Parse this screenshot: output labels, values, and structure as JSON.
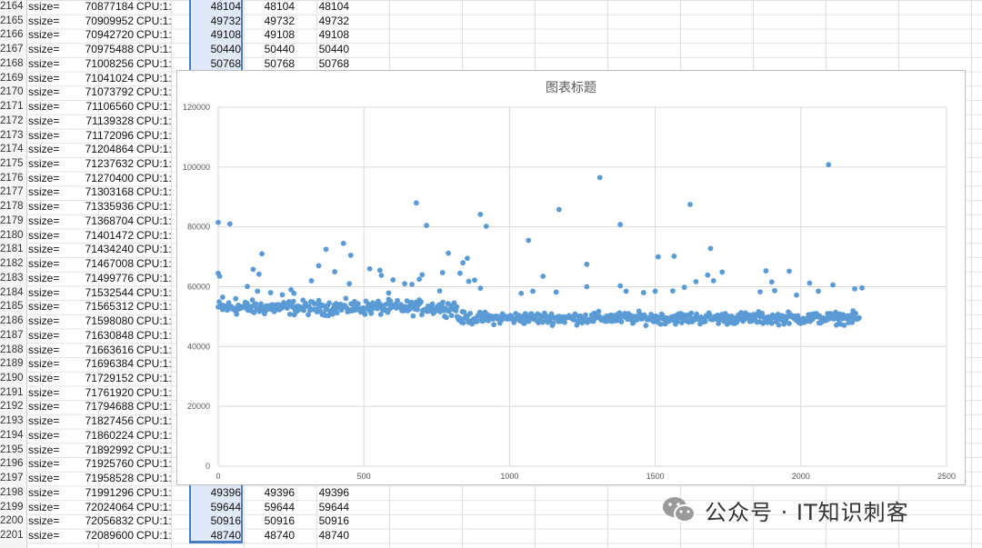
{
  "sheet": {
    "rows": [
      {
        "n": "2164",
        "ss": "ssize=",
        "v": "70877184",
        "cpu": "CPU:1:",
        "d": "48104",
        "e": "48104",
        "f": "48104"
      },
      {
        "n": "2165",
        "ss": "ssize=",
        "v": "70909952",
        "cpu": "CPU:1:",
        "d": "49732",
        "e": "49732",
        "f": "49732"
      },
      {
        "n": "2166",
        "ss": "ssize=",
        "v": "70942720",
        "cpu": "CPU:1:",
        "d": "49108",
        "e": "49108",
        "f": "49108"
      },
      {
        "n": "2167",
        "ss": "ssize=",
        "v": "70975488",
        "cpu": "CPU:1:",
        "d": "50440",
        "e": "50440",
        "f": "50440"
      },
      {
        "n": "2168",
        "ss": "ssize=",
        "v": "71008256",
        "cpu": "CPU:1:",
        "d": "50768",
        "e": "50768",
        "f": "50768"
      },
      {
        "n": "2169",
        "ss": "ssize=",
        "v": "71041024",
        "cpu": "CPU:1:",
        "d": "",
        "e": "",
        "f": ""
      },
      {
        "n": "2170",
        "ss": "ssize=",
        "v": "71073792",
        "cpu": "CPU:1:",
        "d": "",
        "e": "",
        "f": ""
      },
      {
        "n": "2171",
        "ss": "ssize=",
        "v": "71106560",
        "cpu": "CPU:1:",
        "d": "",
        "e": "",
        "f": ""
      },
      {
        "n": "2172",
        "ss": "ssize=",
        "v": "71139328",
        "cpu": "CPU:1:",
        "d": "",
        "e": "",
        "f": ""
      },
      {
        "n": "2173",
        "ss": "ssize=",
        "v": "71172096",
        "cpu": "CPU:1:",
        "d": "",
        "e": "",
        "f": ""
      },
      {
        "n": "2174",
        "ss": "ssize=",
        "v": "71204864",
        "cpu": "CPU:1:",
        "d": "",
        "e": "",
        "f": ""
      },
      {
        "n": "2175",
        "ss": "ssize=",
        "v": "71237632",
        "cpu": "CPU:1:",
        "d": "",
        "e": "",
        "f": ""
      },
      {
        "n": "2176",
        "ss": "ssize=",
        "v": "71270400",
        "cpu": "CPU:1:",
        "d": "",
        "e": "",
        "f": ""
      },
      {
        "n": "2177",
        "ss": "ssize=",
        "v": "71303168",
        "cpu": "CPU:1:",
        "d": "",
        "e": "",
        "f": ""
      },
      {
        "n": "2178",
        "ss": "ssize=",
        "v": "71335936",
        "cpu": "CPU:1:",
        "d": "",
        "e": "",
        "f": ""
      },
      {
        "n": "2179",
        "ss": "ssize=",
        "v": "71368704",
        "cpu": "CPU:1:",
        "d": "",
        "e": "",
        "f": ""
      },
      {
        "n": "2180",
        "ss": "ssize=",
        "v": "71401472",
        "cpu": "CPU:1:",
        "d": "",
        "e": "",
        "f": ""
      },
      {
        "n": "2181",
        "ss": "ssize=",
        "v": "71434240",
        "cpu": "CPU:1:",
        "d": "",
        "e": "",
        "f": ""
      },
      {
        "n": "2182",
        "ss": "ssize=",
        "v": "71467008",
        "cpu": "CPU:1:",
        "d": "",
        "e": "",
        "f": ""
      },
      {
        "n": "2183",
        "ss": "ssize=",
        "v": "71499776",
        "cpu": "CPU:1:",
        "d": "",
        "e": "",
        "f": ""
      },
      {
        "n": "2184",
        "ss": "ssize=",
        "v": "71532544",
        "cpu": "CPU:1:",
        "d": "",
        "e": "",
        "f": ""
      },
      {
        "n": "2185",
        "ss": "ssize=",
        "v": "71565312",
        "cpu": "CPU:1:",
        "d": "",
        "e": "",
        "f": ""
      },
      {
        "n": "2186",
        "ss": "ssize=",
        "v": "71598080",
        "cpu": "CPU:1:",
        "d": "",
        "e": "",
        "f": ""
      },
      {
        "n": "2187",
        "ss": "ssize=",
        "v": "71630848",
        "cpu": "CPU:1:",
        "d": "",
        "e": "",
        "f": ""
      },
      {
        "n": "2188",
        "ss": "ssize=",
        "v": "71663616",
        "cpu": "CPU:1:",
        "d": "",
        "e": "",
        "f": ""
      },
      {
        "n": "2189",
        "ss": "ssize=",
        "v": "71696384",
        "cpu": "CPU:1:",
        "d": "",
        "e": "",
        "f": ""
      },
      {
        "n": "2190",
        "ss": "ssize=",
        "v": "71729152",
        "cpu": "CPU:1:",
        "d": "",
        "e": "",
        "f": ""
      },
      {
        "n": "2191",
        "ss": "ssize=",
        "v": "71761920",
        "cpu": "CPU:1:",
        "d": "",
        "e": "",
        "f": ""
      },
      {
        "n": "2192",
        "ss": "ssize=",
        "v": "71794688",
        "cpu": "CPU:1:",
        "d": "",
        "e": "",
        "f": ""
      },
      {
        "n": "2193",
        "ss": "ssize=",
        "v": "71827456",
        "cpu": "CPU:1:",
        "d": "",
        "e": "",
        "f": ""
      },
      {
        "n": "2194",
        "ss": "ssize=",
        "v": "71860224",
        "cpu": "CPU:1:",
        "d": "",
        "e": "",
        "f": ""
      },
      {
        "n": "2195",
        "ss": "ssize=",
        "v": "71892992",
        "cpu": "CPU:1:",
        "d": "",
        "e": "",
        "f": ""
      },
      {
        "n": "2196",
        "ss": "ssize=",
        "v": "71925760",
        "cpu": "CPU:1:",
        "d": "",
        "e": "",
        "f": ""
      },
      {
        "n": "2197",
        "ss": "ssize=",
        "v": "71958528",
        "cpu": "CPU:1:",
        "d": "",
        "e": "",
        "f": ""
      },
      {
        "n": "2198",
        "ss": "ssize=",
        "v": "71991296",
        "cpu": "CPU:1:",
        "d": "49396",
        "e": "49396",
        "f": "49396"
      },
      {
        "n": "2199",
        "ss": "ssize=",
        "v": "72024064",
        "cpu": "CPU:1:",
        "d": "59644",
        "e": "59644",
        "f": "59644"
      },
      {
        "n": "2200",
        "ss": "ssize=",
        "v": "72056832",
        "cpu": "CPU:1:",
        "d": "50916",
        "e": "50916",
        "f": "50916"
      },
      {
        "n": "2201",
        "ss": "ssize=",
        "v": "72089600",
        "cpu": "CPU:1:",
        "d": "48740",
        "e": "48740",
        "f": "48740"
      }
    ]
  },
  "chart_data": {
    "type": "scatter",
    "title": "图表标题",
    "xlabel": "",
    "ylabel": "",
    "xlim": [
      0,
      2500
    ],
    "ylim": [
      0,
      120000
    ],
    "x_ticks": [
      "0",
      "500",
      "1000",
      "1500",
      "2000",
      "2500"
    ],
    "y_ticks": [
      "0",
      "20000",
      "40000",
      "60000",
      "80000",
      "100000",
      "120000"
    ],
    "grid": true,
    "legend": "none",
    "marker_color": "#5b9bd5",
    "series": [
      {
        "points": [
          [
            0,
            81500
          ],
          [
            40,
            81000
          ],
          [
            0,
            64500
          ],
          [
            5,
            63500
          ],
          [
            15,
            56500
          ],
          [
            150,
            71000
          ],
          [
            120,
            65800
          ],
          [
            140,
            64200
          ],
          [
            100,
            60100
          ],
          [
            135,
            58500
          ],
          [
            370,
            72500
          ],
          [
            430,
            74500
          ],
          [
            455,
            70500
          ],
          [
            400,
            65000
          ],
          [
            345,
            67000
          ],
          [
            320,
            62000
          ],
          [
            520,
            66000
          ],
          [
            555,
            65500
          ],
          [
            560,
            63800
          ],
          [
            450,
            61000
          ],
          [
            680,
            88000
          ],
          [
            715,
            80500
          ],
          [
            700,
            64000
          ],
          [
            690,
            62500
          ],
          [
            665,
            60800
          ],
          [
            790,
            71200
          ],
          [
            770,
            64700
          ],
          [
            840,
            68000
          ],
          [
            855,
            69500
          ],
          [
            830,
            64500
          ],
          [
            900,
            84200
          ],
          [
            920,
            80200
          ],
          [
            880,
            62200
          ],
          [
            900,
            59500
          ],
          [
            860,
            61800
          ],
          [
            1065,
            75500
          ],
          [
            1080,
            58500
          ],
          [
            1115,
            63500
          ],
          [
            1170,
            85800
          ],
          [
            1160,
            58200
          ],
          [
            1265,
            67500
          ],
          [
            1310,
            96500
          ],
          [
            1265,
            60000
          ],
          [
            1380,
            80800
          ],
          [
            1380,
            60300
          ],
          [
            1400,
            58500
          ],
          [
            1510,
            70000
          ],
          [
            1565,
            70200
          ],
          [
            1500,
            58500
          ],
          [
            1460,
            58000
          ],
          [
            1620,
            87500
          ],
          [
            1690,
            72800
          ],
          [
            1680,
            63900
          ],
          [
            1700,
            62000
          ],
          [
            1640,
            61700
          ],
          [
            1730,
            64900
          ],
          [
            1600,
            59800
          ],
          [
            1560,
            58600
          ],
          [
            1880,
            65300
          ],
          [
            1900,
            61600
          ],
          [
            1910,
            58700
          ],
          [
            1960,
            65200
          ],
          [
            1860,
            58300
          ],
          [
            2095,
            100800
          ],
          [
            2030,
            61200
          ],
          [
            2110,
            60600
          ],
          [
            2060,
            58500
          ],
          [
            2185,
            59300
          ],
          [
            2210,
            59600
          ],
          [
            1985,
            57200
          ],
          [
            250,
            59000
          ],
          [
            180,
            58000
          ],
          [
            260,
            57800
          ],
          [
            600,
            62300
          ],
          [
            640,
            61000
          ],
          [
            585,
            57900
          ],
          [
            760,
            58600
          ],
          [
            220,
            57300
          ],
          [
            60,
            56000
          ],
          [
            1040,
            57800
          ]
        ]
      }
    ],
    "dense_band": {
      "segments": [
        {
          "x_from": 0,
          "x_to": 820,
          "center": 53000,
          "spread": 2300
        },
        {
          "x_from": 820,
          "x_to": 2200,
          "center": 49500,
          "spread": 1900
        }
      ]
    }
  },
  "watermark": {
    "icon": "wechat-icon",
    "text": "公众号 · IT知识刺客"
  }
}
